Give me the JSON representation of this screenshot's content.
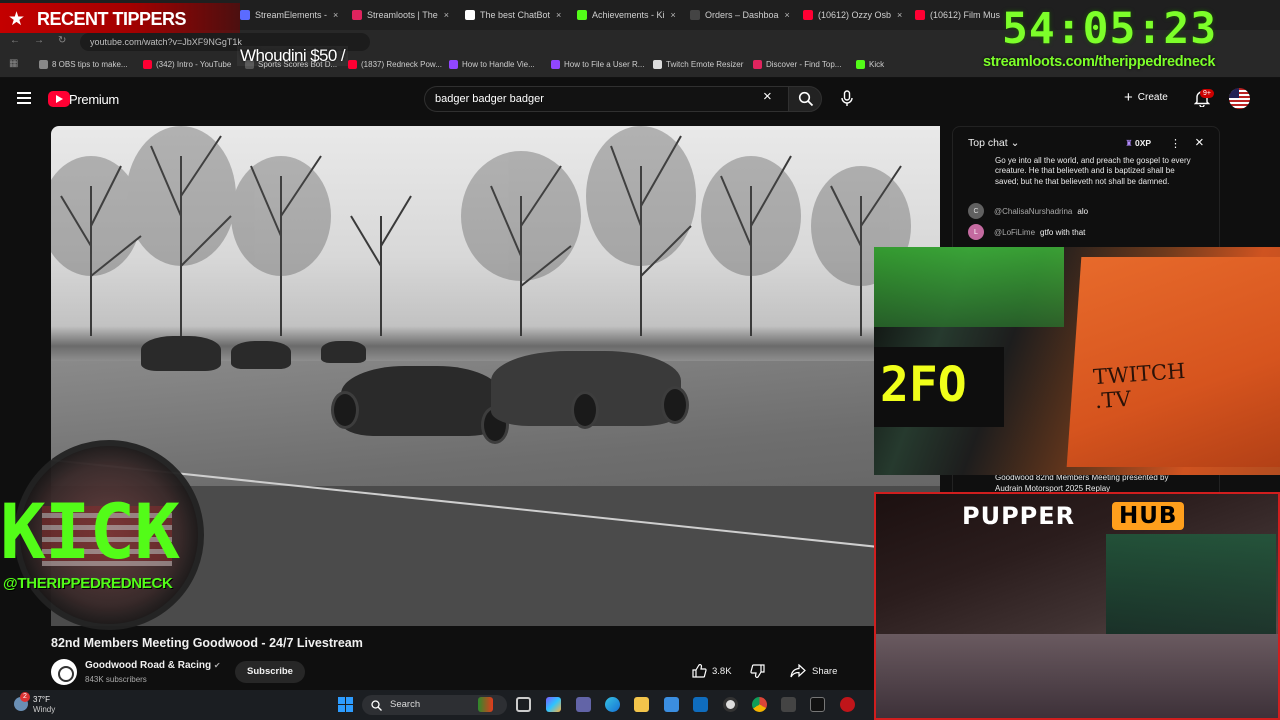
{
  "overlay": {
    "tippers_label": "RECENT TIPPERS",
    "tipper_entry": "Whoudini $50 /",
    "timer": "54:05:23",
    "loot_url": "streamloots.com/therippedredneck",
    "kick_word": "KICK",
    "kick_handle": "@THERIPPEDREDNECK",
    "webcam_box_text": "TWITCH\n.TV",
    "pupper_title": "PUPPER",
    "pupper_hub": "HUB"
  },
  "browser": {
    "tabs": [
      {
        "label": "StreamElements -",
        "color": "#5b6bff"
      },
      {
        "label": "Streamloots | The",
        "color": "#e0245e"
      },
      {
        "label": "The best ChatBot",
        "color": "#ffffff"
      },
      {
        "label": "Achievements - Ki",
        "color": "#53fc18"
      },
      {
        "label": "Orders – Dashboa",
        "color": "#333333"
      },
      {
        "label": "(10612) Ozzy Osb",
        "color": "#ff0033"
      },
      {
        "label": "(10612) Film Musi",
        "color": "#ff0033"
      }
    ],
    "tab_close_glyph": "×",
    "url": "youtube.com/watch?v=JbXF9NGgT1k",
    "bookmarks": [
      {
        "label": "8 OBS tips to make...",
        "color": "#888888"
      },
      {
        "label": "(342) Intro - YouTube",
        "color": "#ff0033"
      },
      {
        "label": "Sports Scores Bot D...",
        "color": "#555555"
      },
      {
        "label": "(1837) Redneck Pow...",
        "color": "#ff0033"
      },
      {
        "label": "How to Handle Vie...",
        "color": "#9146ff"
      },
      {
        "label": "How to File a User R...",
        "color": "#9146ff"
      },
      {
        "label": "Twitch Emote Resizer",
        "color": "#dddddd"
      },
      {
        "label": "Discover - Find Top...",
        "color": "#e0245e"
      },
      {
        "label": "Kick",
        "color": "#53fc18"
      }
    ]
  },
  "youtube": {
    "brand": "Premium",
    "search_query": "badger badger badger",
    "create_label": "Create",
    "notif_count": "9+",
    "video_title": "82nd Members Meeting Goodwood - 24/7 Livestream",
    "channel_name": "Goodwood Road & Racing",
    "channel_verified": "✔",
    "channel_subs": "843K subscribers",
    "subscribe_label": "Subscribe",
    "like_count": "3.8K",
    "share_label": "Share"
  },
  "chat": {
    "mode": "Top chat",
    "xp": "0XP",
    "verse": "Go ye into all the world, and preach the gospel to every creature. He that believeth and is baptized shall be saved; but he that believeth not shall be damned.",
    "messages": [
      {
        "initial": "C",
        "author": "@ChalisaNurshadrina",
        "text": "alo",
        "color": "#606060"
      },
      {
        "initial": "L",
        "author": "@LoFiLime",
        "text": "gtfo with that",
        "color": "#c46aa0"
      }
    ],
    "pinned": "Goodwood 82nd Members Meeting presented by Audrain Motorsport 2025 Replay"
  },
  "taskbar": {
    "weather_temp": "37°F",
    "weather_desc": "Windy",
    "weather_badge": "2",
    "search_label": "Search"
  },
  "colors": {
    "kick_green": "#53fc18",
    "timer_green": "#7dff2a",
    "yt_red": "#ff0033",
    "pupper_orange": "#ff9f1c"
  }
}
